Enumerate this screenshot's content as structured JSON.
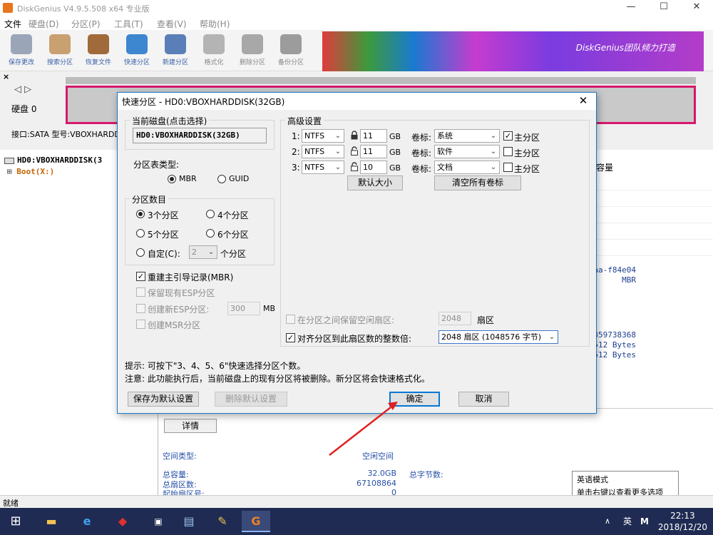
{
  "app": {
    "title": "DiskGenius V4.9.5.508 x64 专业版",
    "menu": [
      "文件",
      "硬盘(D)",
      "分区(P)",
      "工具(T)",
      "查看(V)",
      "帮助(H)"
    ],
    "toolbar": [
      "保存更改",
      "搜索分区",
      "恢复文件",
      "快速分区",
      "新建分区",
      "格式化",
      "删除分区",
      "备份分区"
    ],
    "banner_text": "DiskGenius团队倾力打造",
    "disk_label": "硬盘 0",
    "interface_line": "接口:SATA  型号:VBOXHARDDI",
    "tree": {
      "disk": "HD0:VBOXHARDDISK(3",
      "partition": "Boot(X:)"
    },
    "right_panel": {
      "column_capacity": "容量",
      "guid_tail": "53aa-f84e04",
      "mbr": "MBR",
      "bytes_value": "34359738368",
      "sector_size_1": "512 Bytes",
      "sector_size_2": "512 Bytes",
      "details_button": "详情",
      "space_type_label": "空间类型:",
      "space_type_value": "空闲空间",
      "total_capacity_label": "总容量:",
      "total_capacity_value": "32.0GB",
      "total_bytes_label": "总字节数:",
      "total_bytes_value": "34359738368",
      "total_sectors_label": "总扇区数:",
      "total_sectors_value": "67108864",
      "start_sector_label": "起始扇区号:",
      "start_sector_value": "0"
    },
    "tooltip": {
      "line1": "英语模式",
      "line2": "单击右键以查看更多选项"
    },
    "status": "就绪"
  },
  "taskbar": {
    "ime": "英",
    "time": "22:13",
    "date": "2018/12/20"
  },
  "dialog": {
    "title": "快速分区 - HD0:VBOXHARDDISK(32GB)",
    "current_disk": {
      "title": "当前磁盘(点击选择)",
      "value": "HD0:VBOXHARDDISK(32GB)"
    },
    "partition_table": {
      "title": "分区表类型:",
      "options": [
        "MBR",
        "GUID"
      ],
      "selected": "MBR"
    },
    "partition_count": {
      "title": "分区数目",
      "options": [
        "3个分区",
        "4个分区",
        "5个分区",
        "6个分区"
      ],
      "selected": "3个分区",
      "custom_label": "自定(C):",
      "custom_value": "2",
      "custom_suffix": "个分区"
    },
    "options": {
      "rebuild_mbr": "重建主引导记录(MBR)",
      "keep_esp": "保留现有ESP分区",
      "create_esp": "创建新ESP分区:",
      "esp_size": "300",
      "esp_unit": "MB",
      "create_msr": "创建MSR分区"
    },
    "advanced": {
      "title": "高级设置",
      "size_unit": "GB",
      "volume_label_caption": "卷标:",
      "primary_caption": "主分区",
      "partitions": [
        {
          "index": "1:",
          "fs": "NTFS",
          "size": "11",
          "label": "系统",
          "primary": true
        },
        {
          "index": "2:",
          "fs": "NTFS",
          "size": "11",
          "label": "软件",
          "primary": false
        },
        {
          "index": "3:",
          "fs": "NTFS",
          "size": "10",
          "label": "文档",
          "primary": false
        }
      ],
      "default_size_button": "默认大小",
      "clear_labels_button": "清空所有卷标",
      "keep_free_label": "在分区之间保留空闲扇区:",
      "keep_free_value": "2048",
      "keep_free_unit": "扇区",
      "align_label": "对齐分区到此扇区数的整数倍:",
      "align_value": "2048 扇区 (1048576 字节)"
    },
    "hint1": "提示: 可按下\"3、4、5、6\"快速选择分区个数。",
    "hint2": "注意: 此功能执行后，当前磁盘上的现有分区将被删除。新分区将会快速格式化。",
    "buttons": {
      "save_default": "保存为默认设置",
      "delete_default": "删除默认设置",
      "ok": "确定",
      "cancel": "取消"
    }
  },
  "colors": {
    "accent": "#0078d7",
    "disk_border": "#d6186b",
    "arrow": "#e02020"
  }
}
